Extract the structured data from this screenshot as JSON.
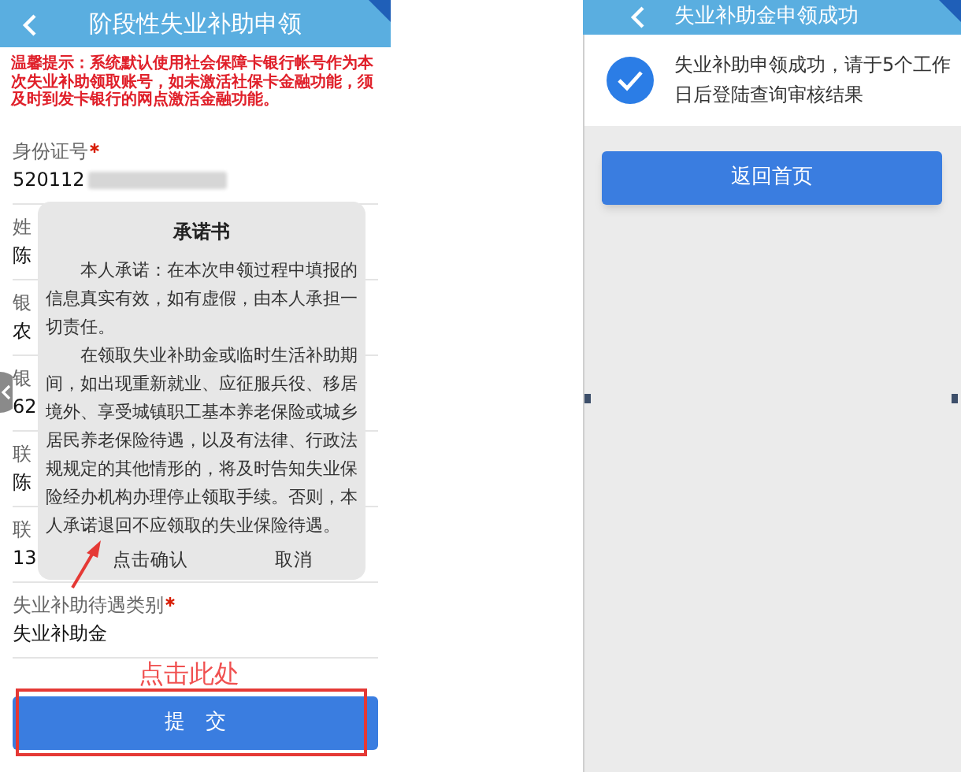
{
  "left_screen": {
    "header": {
      "title": "阶段性失业补助申领"
    },
    "notice": "温馨提示：系统默认使用社会保障卡银行帐号作为本次失业补助领取账号，如未激活社保卡金融功能，须及时到发卡银行的网点激活金融功能。",
    "fields": [
      {
        "label": "身份证号",
        "required": true,
        "value": "520112",
        "redacted": true
      },
      {
        "label": "姓",
        "value": "陈"
      },
      {
        "label": "银",
        "value": "农"
      },
      {
        "label": "银",
        "value": "62"
      },
      {
        "label": "联",
        "value": "陈"
      },
      {
        "label": "联",
        "value": "13"
      },
      {
        "label": "失业补助待遇类别",
        "required": true,
        "value": "失业补助金"
      }
    ],
    "submit_button": "提　交"
  },
  "dialog": {
    "title": "承诺书",
    "paragraphs": [
      "本人承诺：在本次申领过程中填报的信息真实有效，如有虚假，由本人承担一切责任。",
      "在领取失业补助金或临时生活补助期间，如出现重新就业、应征服兵役、移居境外、享受城镇职工基本养老保险或城乡居民养老保险待遇，以及有法律、行政法规规定的其他情形的，将及时告知失业保险经办机构办理停止领取手续。否则，本人承诺退回不应领取的失业保险待遇。"
    ],
    "buttons": [
      "点击确认",
      "取消"
    ]
  },
  "annotations": {
    "hint": "点击此处"
  },
  "right_screen": {
    "header": {
      "title": "失业补助金申领成功"
    },
    "message_lines": [
      "失业补助申领成功，请于5个工作",
      "日后登陆查询审核结果"
    ],
    "button": "返回首页"
  }
}
